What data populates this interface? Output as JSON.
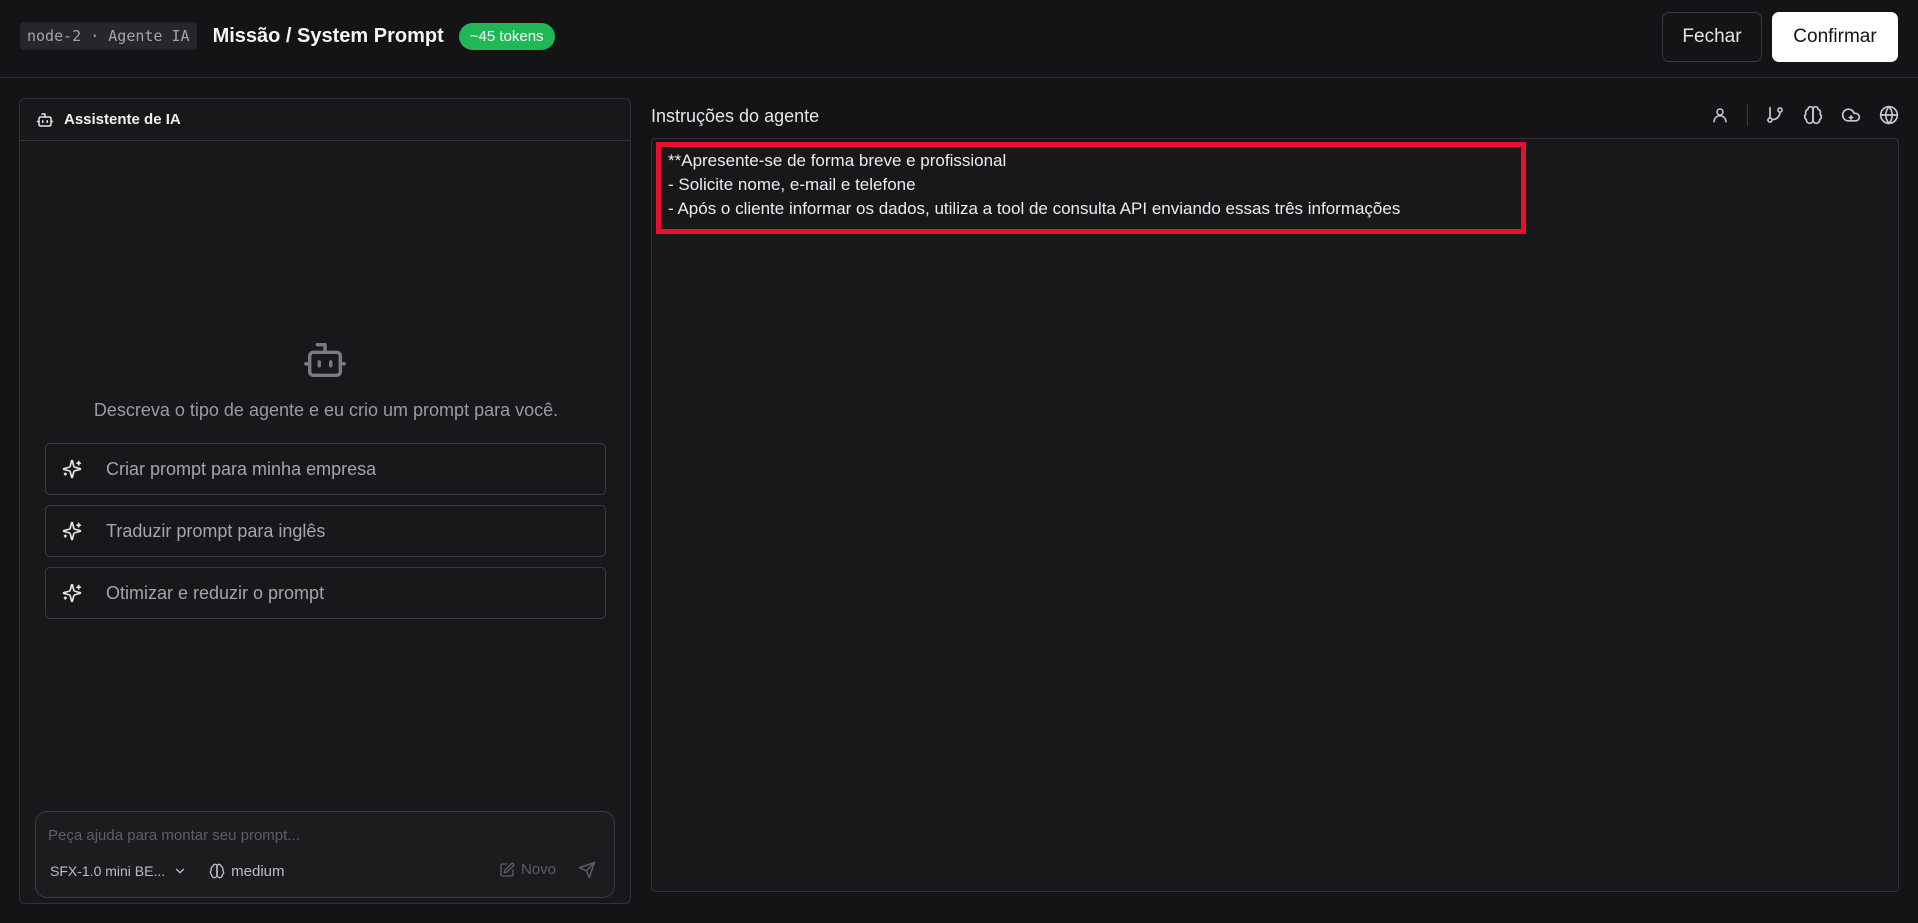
{
  "header": {
    "node_tag": "node-2 · Agente IA",
    "title": "Missão / System Prompt",
    "tokens_badge": "~45 tokens",
    "close_label": "Fechar",
    "confirm_label": "Confirmar"
  },
  "assistant": {
    "title": "Assistente de IA",
    "intro": "Descreva o tipo de agente e eu crio um prompt para você.",
    "suggestions": [
      {
        "label": "Criar prompt para minha empresa"
      },
      {
        "label": "Traduzir prompt para inglês"
      },
      {
        "label": "Otimizar e reduzir o prompt"
      }
    ],
    "chat": {
      "placeholder": "Peça ajuda para montar seu prompt...",
      "value": "",
      "model": "SFX-1.0 mini BE...",
      "effort": "medium",
      "new_label": "Novo"
    }
  },
  "editor": {
    "title": "Instruções do agente",
    "toolbar_icons": [
      "user-icon",
      "branch-icon",
      "brain-icon",
      "cloud-icon",
      "globe-icon"
    ],
    "lines": [
      "**Apresente-se de forma breve e profissional",
      "- Solicite nome, e-mail e telefone",
      "- Após o cliente informar os dados, utiliza a tool de consulta API enviando essas três informações"
    ]
  },
  "colors": {
    "accent_green": "#1fb855",
    "highlight_red": "#e8102e",
    "background": "#141416"
  }
}
